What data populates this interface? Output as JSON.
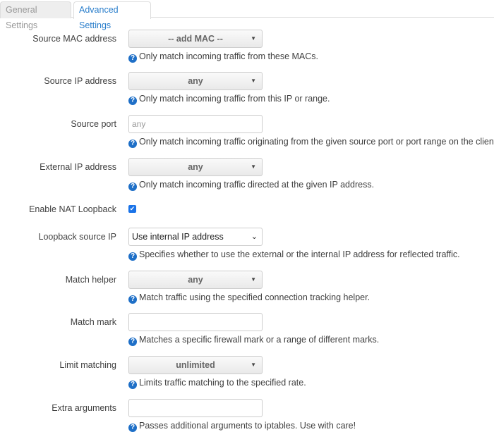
{
  "tabs": [
    {
      "label": "General Settings",
      "active": false
    },
    {
      "label": "Advanced Settings",
      "active": true
    }
  ],
  "fields": {
    "src_mac": {
      "label": "Source MAC address",
      "value": "-- add MAC --",
      "help": "Only match incoming traffic from these MACs."
    },
    "src_ip": {
      "label": "Source IP address",
      "value": "any",
      "help": "Only match incoming traffic from this IP or range."
    },
    "src_port": {
      "label": "Source port",
      "placeholder": "any",
      "help": "Only match incoming traffic originating from the given source port or port range on the client host"
    },
    "ext_ip": {
      "label": "External IP address",
      "value": "any",
      "help": "Only match incoming traffic directed at the given IP address."
    },
    "nat_loopback": {
      "label": "Enable NAT Loopback",
      "checked": true
    },
    "loopback_src": {
      "label": "Loopback source IP",
      "value": "Use internal IP address",
      "help": "Specifies whether to use the external or the internal IP address for reflected traffic."
    },
    "helper": {
      "label": "Match helper",
      "value": "any",
      "help": "Match traffic using the specified connection tracking helper."
    },
    "mark": {
      "label": "Match mark",
      "value": "",
      "help": "Matches a specific firewall mark or a range of different marks."
    },
    "limit": {
      "label": "Limit matching",
      "value": "unlimited",
      "help": "Limits traffic matching to the specified rate."
    },
    "extra": {
      "label": "Extra arguments",
      "value": "",
      "help": "Passes additional arguments to iptables. Use with care!"
    }
  },
  "icons": {
    "help": "question-circle-icon",
    "caret": "caret-down-icon",
    "check": "checkmark-icon"
  },
  "colors": {
    "accent": "#2a7ecb",
    "help_icon": "#1e6fc7",
    "checkbox": "#1a73e8"
  }
}
